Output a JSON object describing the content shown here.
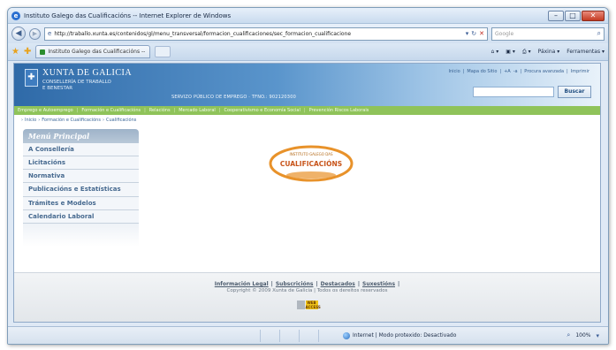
{
  "window": {
    "title": "Instituto Galego das Cualificacións -- Internet Explorer de Windows",
    "minimize": "–",
    "maximize": "□",
    "close": "✕"
  },
  "address": {
    "url": "http://traballo.xunta.es/contenidos/gl/menu_transversal/formacion_cualificaciones/sec_formacion_cualificacione",
    "search_placeholder": "Google"
  },
  "tab": {
    "label": "Instituto Galego das Cualificacións --"
  },
  "commands": [
    "Páxina ▾",
    "Ferramentas ▾"
  ],
  "site": {
    "title": "XUNTA DE GALICIA",
    "subtitle_1": "CONSELLERÍA DE TRABALLO",
    "subtitle_2": "E BENESTAR",
    "servizo": "SERVIZO PÚBLICO DE EMPREGO · TFNO.: 902120300",
    "toplinks": [
      "Inicio",
      "Mapa do Sitio",
      "+A",
      "-a",
      "Procura avanzada",
      "Imprimir"
    ],
    "search_button": "Buscar",
    "green_nav": [
      "Emprego e Autoemprego",
      "Formación e Cualificacións",
      "Relacións",
      "Mercado Laboral",
      "Cooperativismo e Economía Social",
      "Prevención Riscos Laborais"
    ],
    "breadcrumb": [
      "Inicio",
      "Formación e Cualificacións",
      "Cualificacións"
    ],
    "menu_title": "Menú Principal",
    "menu": [
      "A Consellería",
      "Licitacións",
      "Normativa",
      "Publicacións e Estatísticas",
      "Trámites e Modelos",
      "Calendario Laboral"
    ],
    "logo": {
      "top": "INSTITUTO GALEGO DAS",
      "main": "CUALIFICACIÓNS"
    },
    "footer_links": [
      "Información Legal",
      "Subscricións",
      "Destacados",
      "Suxestións"
    ],
    "copyright": "Copyright © 2009 Xunta de Galicia | Todos os dereitos reservados",
    "badge_text": "WEB ACCESS"
  },
  "status": {
    "zone": "Internet | Modo protexido: Desactivado",
    "zoom": "100%"
  },
  "colors": {
    "header_blue": "#2f6aa8",
    "nav_green": "#8fc35a",
    "logo_orange": "#e8922a"
  }
}
